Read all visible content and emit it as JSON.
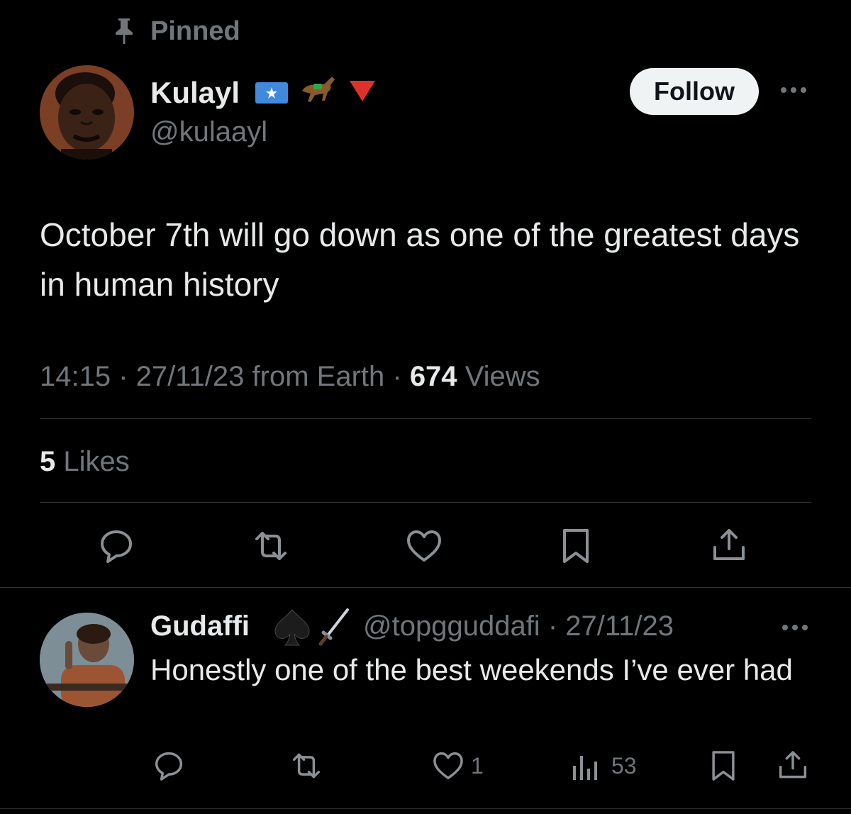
{
  "pinned": {
    "label": "Pinned",
    "icon": "pin-icon"
  },
  "author": {
    "name": "Kulayl",
    "handle": "@kulaayl",
    "badges": [
      "somalia-flag-icon",
      "horse-racing-icon",
      "red-triangle-icon"
    ]
  },
  "follow_label": "Follow",
  "tweet": {
    "text": "October 7th will go down as one of the greatest days in human history",
    "time": "14:15",
    "date": "27/11/23",
    "source": "from Earth",
    "views_count": "674",
    "views_label": "Views",
    "likes_count": "5",
    "likes_label": "Likes"
  },
  "actions": [
    "reply-icon",
    "retweet-icon",
    "like-icon",
    "bookmark-icon",
    "share-icon"
  ],
  "reply": {
    "name": "Gudaffi",
    "badges": [
      "spade-icon",
      "dagger-icon"
    ],
    "handle": "@topgguddafi",
    "date": "27/11/23",
    "text": "Honestly one of the best weekends I’ve ever had",
    "likes": "1",
    "views": "53"
  },
  "colors": {
    "background": "#000000",
    "text": "#e7e9ea",
    "secondary": "#71767b",
    "divider": "#2f3336",
    "follow_bg": "#eff3f4"
  }
}
